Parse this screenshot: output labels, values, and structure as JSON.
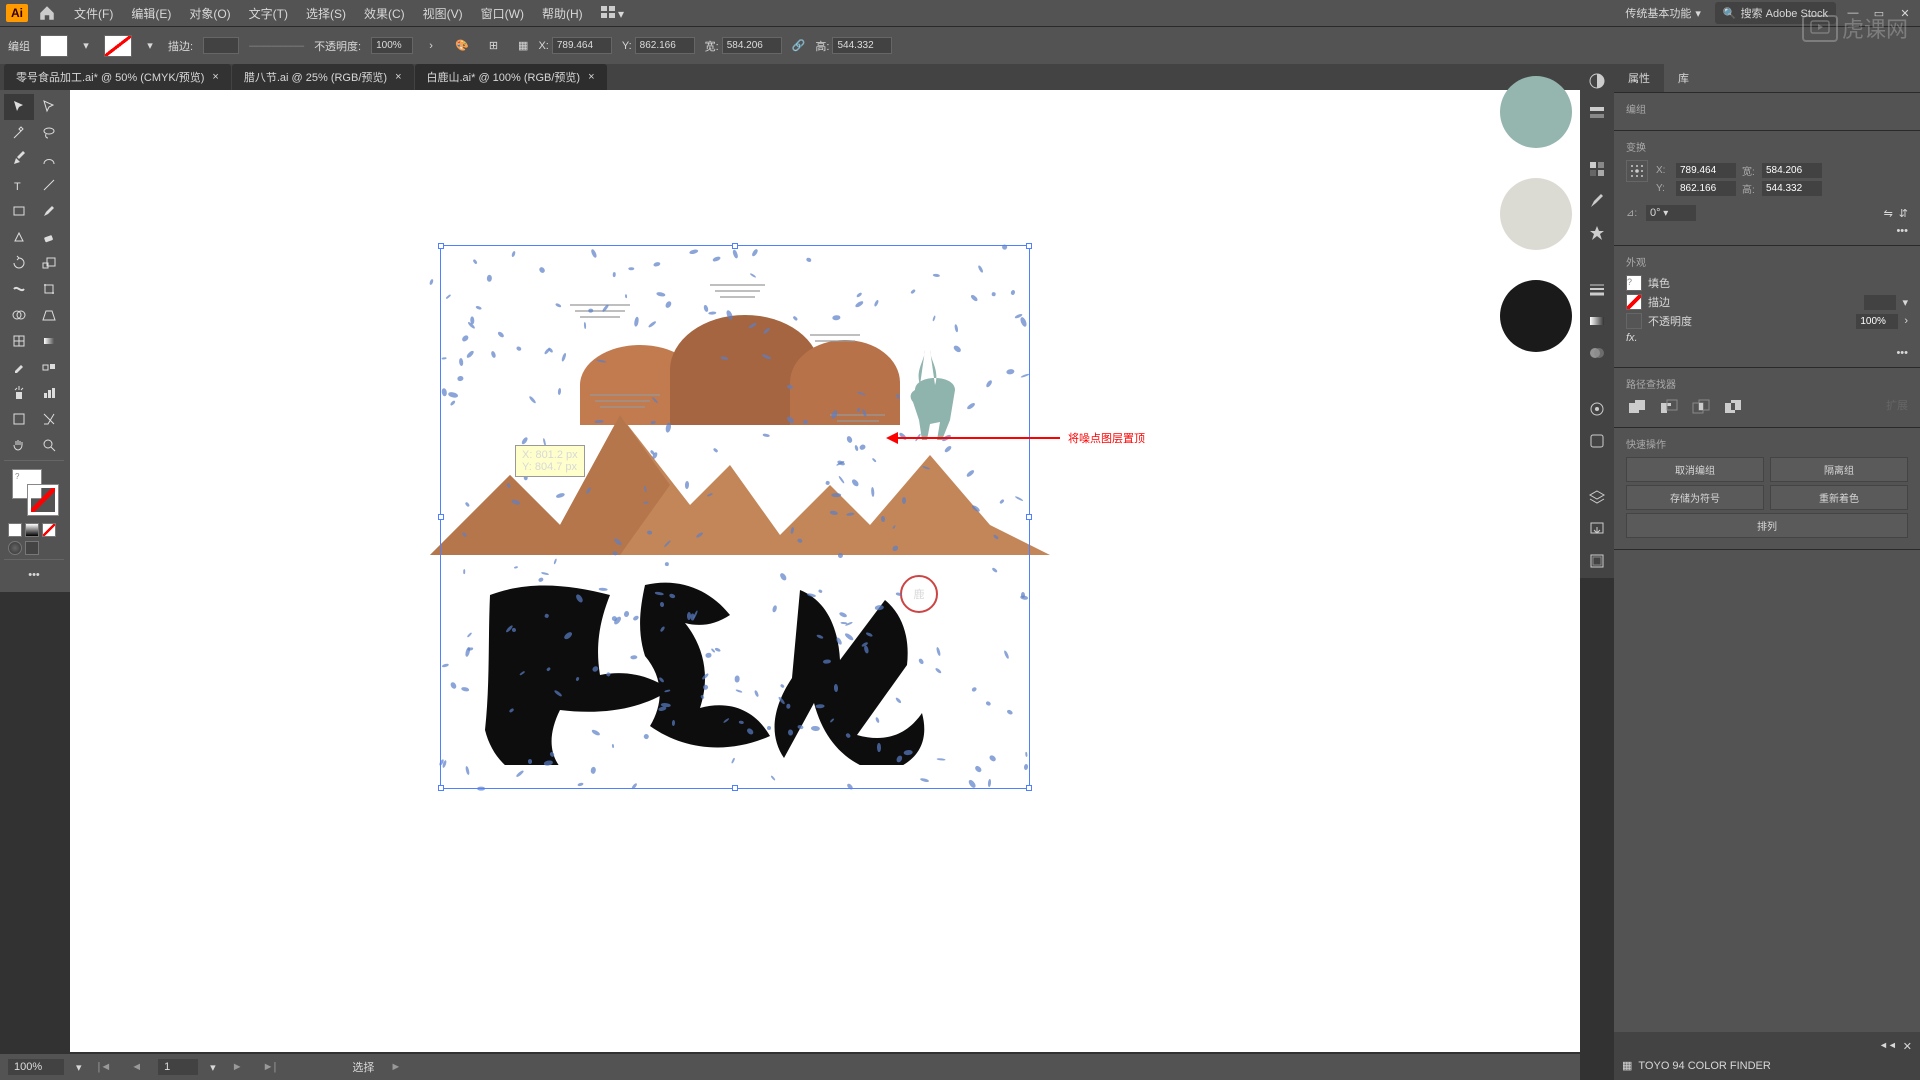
{
  "menubar": {
    "logo": "Ai",
    "items": [
      "文件(F)",
      "编辑(E)",
      "对象(O)",
      "文字(T)",
      "选择(S)",
      "效果(C)",
      "视图(V)",
      "窗口(W)",
      "帮助(H)"
    ],
    "workspace": "传统基本功能",
    "search_placeholder": "搜索 Adobe Stock"
  },
  "controlbar": {
    "object_type": "编组",
    "stroke_label": "描边:",
    "opacity_label": "不透明度:",
    "opacity_value": "100%",
    "x_label": "X:",
    "x_value": "789.464",
    "y_label": "Y:",
    "y_value": "862.166",
    "w_label": "宽:",
    "w_value": "584.206",
    "h_label": "高:",
    "h_value": "544.332"
  },
  "tabs": [
    {
      "label": "零号食品加工.ai* @ 50% (CMYK/预览)",
      "active": false
    },
    {
      "label": "腊八节.ai @ 25% (RGB/预览)",
      "active": false
    },
    {
      "label": "白鹿山.ai* @ 100% (RGB/预览)",
      "active": true
    }
  ],
  "canvas": {
    "tooltip_x": "X: 801.2 px",
    "tooltip_y": "Y: 804.7 px",
    "annotation": "将噪点图层置顶",
    "seal_char": "鹿"
  },
  "color_picks": [
    "#95b5af",
    "#dcdbd3",
    "#1a1a1a"
  ],
  "properties": {
    "tabs": [
      "属性",
      "库"
    ],
    "object_label": "编组",
    "transform_title": "变换",
    "x_label": "X:",
    "x_value": "789.464",
    "y_label": "Y:",
    "y_value": "862.166",
    "w_label": "宽:",
    "w_value": "584.206",
    "h_label": "高:",
    "h_value": "544.332",
    "rotate_label": "⊿:",
    "rotate_value": "0°",
    "appearance_title": "外观",
    "fill_label": "填色",
    "stroke_label": "描边",
    "opacity_label": "不透明度",
    "opacity_value": "100%",
    "pathfinder_title": "路径查找器",
    "quick_title": "快速操作",
    "btn_ungroup": "取消编组",
    "btn_isolate": "隔离组",
    "btn_save_symbol": "存储为符号",
    "btn_recolor": "重新着色",
    "btn_arrange": "排列"
  },
  "swatches": {
    "title": "TOYO 94 COLOR FINDER"
  },
  "statusbar": {
    "zoom": "100%",
    "artboard": "1",
    "tool": "选择"
  },
  "watermark": "虎课网"
}
